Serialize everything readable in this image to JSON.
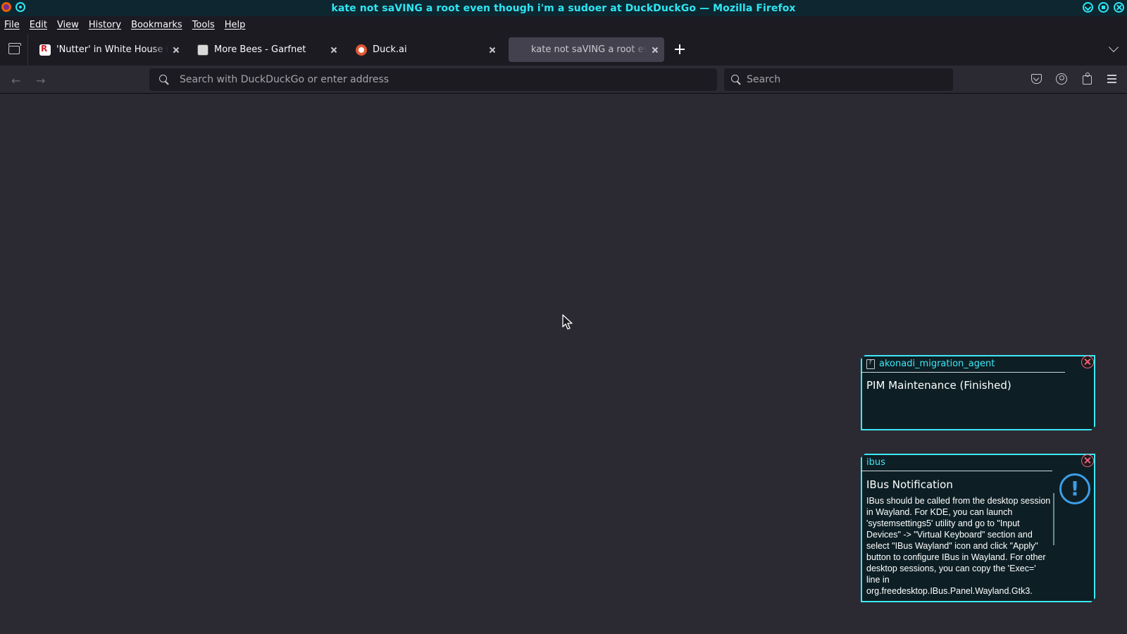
{
  "window": {
    "title": "kate not saVING a root even though i'm a sudoer at DuckDuckGo — Mozilla Firefox",
    "accent_color": "#2ee6f2"
  },
  "menubar": {
    "items": [
      "File",
      "Edit",
      "View",
      "History",
      "Bookmarks",
      "Tools",
      "Help"
    ]
  },
  "tabs": [
    {
      "label": "'Nutter' in White House is",
      "favicon": "reuters-icon",
      "active": false
    },
    {
      "label": "More Bees - Garfnet",
      "favicon": "garfnet-icon",
      "active": false
    },
    {
      "label": "Duck.ai",
      "favicon": "duckai-icon",
      "active": false
    },
    {
      "label": "kate not saVING a root ev",
      "favicon": "none",
      "active": true
    }
  ],
  "navbar": {
    "url_placeholder": "Search with DuckDuckGo or enter address",
    "search_placeholder": "Search",
    "back_glyph": "←",
    "forward_glyph": "→"
  },
  "notifications": [
    {
      "app": "akonadi_migration_agent",
      "app_icon": "file-unknown-icon",
      "title": "PIM Maintenance (Finished)",
      "body": ""
    },
    {
      "app": "ibus",
      "app_icon": "none",
      "title": "IBus Notification",
      "body": "IBus should be called from the desktop session in Wayland. For KDE, you can launch 'systemsettings5' utility and go to \"Input Devices\" -> \"Virtual Keyboard\" section and select \"IBus Wayland\" icon and click \"Apply\" button to configure IBus in Wayland. For other desktop sessions, you can copy the 'Exec=' line in org.freedesktop.IBus.Panel.Wayland.Gtk3.",
      "icon": "info-icon",
      "icon_glyph": "!"
    }
  ],
  "colors": {
    "notification_border": "#3ee8f5",
    "notification_close": "#f0607a",
    "info_icon": "#3d9ee8"
  }
}
